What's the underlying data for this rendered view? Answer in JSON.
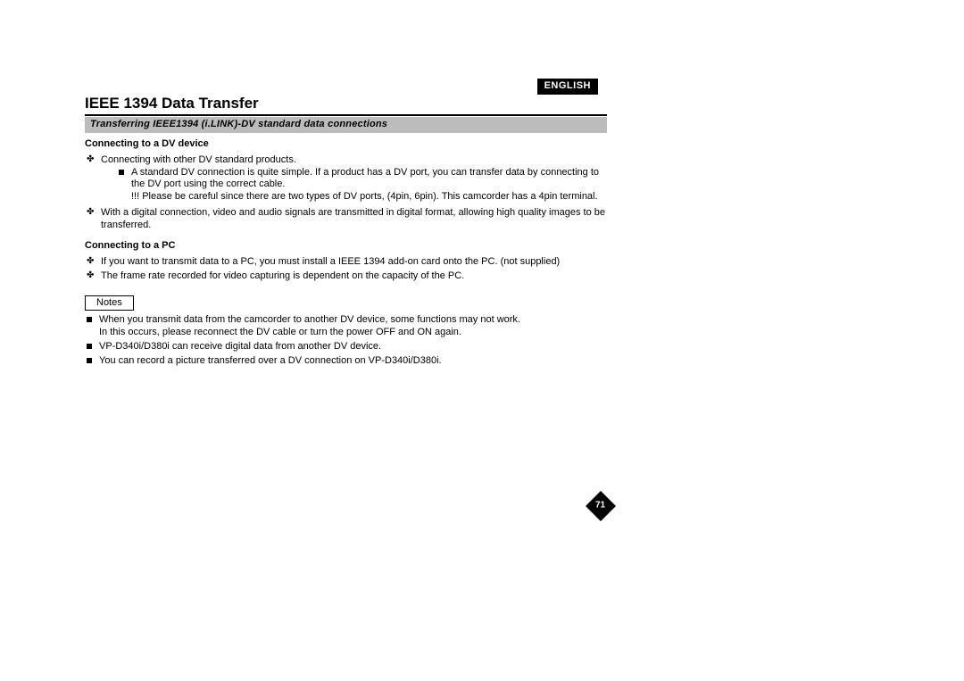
{
  "language_badge": "ENGLISH",
  "title": "IEEE 1394 Data Transfer",
  "subtitle": "Transferring IEEE1394 (i.LINK)-DV standard data connections",
  "section_dv": {
    "heading": "Connecting to a DV device",
    "items": {
      "i0": "Connecting with other DV standard products.",
      "i0_sub0": "A standard DV connection is quite simple. If a product has a DV port, you can transfer data by connecting to the DV port using the correct cable.",
      "i0_sub0_warn": "!!! Please be careful since there are two types of DV ports, (4pin, 6pin). This camcorder has a 4pin terminal.",
      "i1": "With a digital connection, video and audio signals are transmitted in digital format, allowing high quality images to be transferred."
    }
  },
  "section_pc": {
    "heading": "Connecting to a PC",
    "items": {
      "i0": "If you want to transmit data to a PC, you must install a IEEE 1394 add-on card onto the PC. (not supplied)",
      "i1": "The frame rate recorded for video capturing is dependent on the capacity of the PC."
    }
  },
  "notes": {
    "label": "Notes",
    "items": {
      "n0a": "When you transmit data from the camcorder to another DV device, some functions may not work.",
      "n0b": "In this occurs, please reconnect the DV cable or turn the power OFF and ON again.",
      "n1": "VP-D340i/D380i can receive digital data from another DV device.",
      "n2": "You can record a picture transferred over a DV connection on VP-D340i/D380i."
    }
  },
  "page_number": "71"
}
